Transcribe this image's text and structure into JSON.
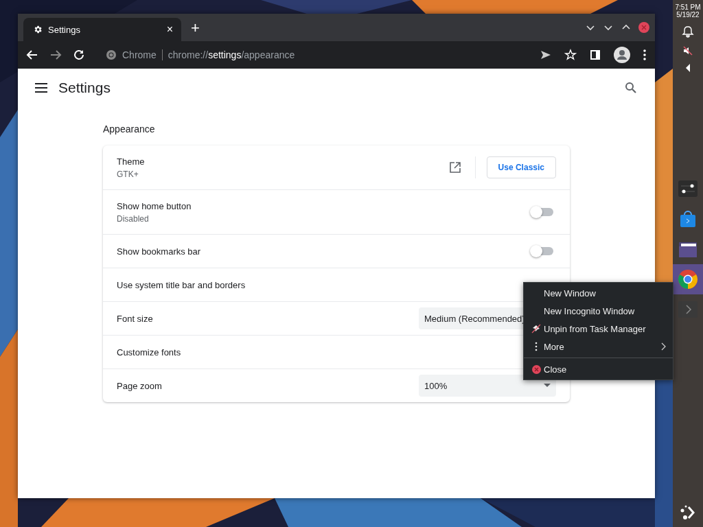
{
  "clock": {
    "time": "7:51 PM",
    "date": "5/19/22"
  },
  "taskbar": {
    "items": [
      {
        "kind": "settings",
        "selected": false
      },
      {
        "kind": "store",
        "selected": false
      },
      {
        "kind": "folder",
        "selected": false
      },
      {
        "kind": "chrome",
        "selected": true
      },
      {
        "kind": "terminal",
        "selected": false
      }
    ]
  },
  "browser": {
    "tab": {
      "title": "Settings",
      "close": "×"
    },
    "new_tab": "+",
    "omnibox": {
      "site": "Chrome",
      "scheme": "chrome://",
      "host": "settings",
      "path": "/appearance"
    }
  },
  "settings": {
    "title": "Settings",
    "section": "Appearance",
    "rows": [
      {
        "kind": "theme",
        "label": "Theme",
        "sublabel": "GTK+",
        "button": "Use Classic"
      },
      {
        "kind": "toggle",
        "label": "Show home button",
        "sublabel": "Disabled",
        "on": false
      },
      {
        "kind": "toggle",
        "label": "Show bookmarks bar",
        "on": false
      },
      {
        "kind": "plain",
        "label": "Use system title bar and borders"
      },
      {
        "kind": "select",
        "label": "Font size",
        "value": "Medium (Recommended)"
      },
      {
        "kind": "plain",
        "label": "Customize fonts"
      },
      {
        "kind": "select",
        "label": "Page zoom",
        "value": "100%",
        "arrow": true
      }
    ]
  },
  "context_menu": {
    "items": [
      {
        "kind": "plain",
        "label": "New Window"
      },
      {
        "kind": "plain",
        "label": "New Incognito Window"
      },
      {
        "kind": "unpin",
        "label": "Unpin from Task Manager"
      },
      {
        "kind": "submenu",
        "label": "More"
      },
      {
        "kind": "close",
        "label": "Close"
      }
    ]
  }
}
